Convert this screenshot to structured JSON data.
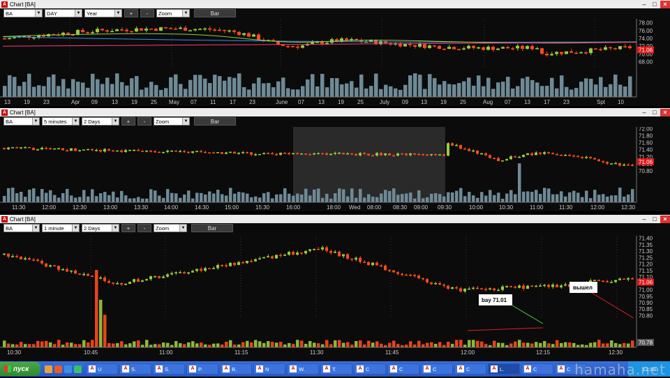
{
  "colors": {
    "up": "#9ccc3a",
    "down": "#ff4a1a",
    "volume": "#6e8a96",
    "price_tag": "#e01818",
    "grid": "#3a3a3a",
    "ma1": "#3a8ee6",
    "ma2": "#8fd13a",
    "ma3": "#ff3a7a"
  },
  "windows": [
    {
      "title": "Chart [BA]",
      "toolbar": {
        "symbol": "BA",
        "interval": "DAY",
        "range": "Year",
        "plus": "+",
        "minus": "-",
        "zoom": "Zoom",
        "style": "Bar"
      },
      "price_axis": [
        "78.00",
        "76.00",
        "74.00",
        "72.00",
        "70.00",
        "68.00"
      ],
      "price_tag": "71.06",
      "time_axis": [
        "13",
        "19",
        "23",
        "Apr",
        "09",
        "13",
        "19",
        "25",
        "May",
        "07",
        "11",
        "17",
        "23",
        "June",
        "07",
        "13",
        "19",
        "25",
        "July",
        "09",
        "13",
        "19",
        "25",
        "Aug",
        "07",
        "13",
        "17",
        "23",
        "Spt",
        "10"
      ],
      "chart_data": {
        "type": "candlestick",
        "y_min": 66.5,
        "y_max": 79.0,
        "y_ticks": [
          78,
          76,
          74,
          72,
          70,
          68
        ],
        "last": 71.06
      }
    },
    {
      "title": "Chart [BA]",
      "toolbar": {
        "symbol": "BA",
        "interval": "5 minutes",
        "range": "2 Days",
        "plus": "+",
        "minus": "-",
        "zoom": "Zoom",
        "style": "Bar"
      },
      "price_axis": [
        "72.00",
        "71.80",
        "71.60",
        "71.40",
        "71.20",
        "71.00",
        "70.80"
      ],
      "price_tag": "71.06",
      "time_axis": [
        "11:30",
        "12:00",
        "12:30",
        "13:00",
        "13:30",
        "14:00",
        "14:30",
        "15:00",
        "15:30",
        "16:00",
        "18:00",
        "Wed",
        "08:00",
        "08:30",
        "09:00",
        "09:30",
        "10:00",
        "10:30",
        "11:00",
        "11:30",
        "12:00",
        "12:30"
      ],
      "chart_data": {
        "type": "candlestick",
        "y_min": 70.7,
        "y_max": 72.05,
        "y_ticks": [
          72.0,
          71.8,
          71.6,
          71.4,
          71.2,
          71.0,
          70.8
        ],
        "last": 71.06
      }
    },
    {
      "title": "Chart [BA]",
      "toolbar": {
        "symbol": "BA",
        "interval": "1 minute",
        "range": "2 Days",
        "plus": "+",
        "minus": "-",
        "zoom": "Zoom",
        "style": "Bar"
      },
      "price_axis": [
        "71.40",
        "71.35",
        "71.30",
        "71.25",
        "71.20",
        "71.15",
        "71.10",
        "71.05",
        "71.00",
        "70.95",
        "70.90",
        "70.85",
        "70.80"
      ],
      "price_tag": "71.06",
      "volume_tag": "70.78",
      "time_axis": [
        "10:30",
        "10:45",
        "11:00",
        "11:15",
        "11:30",
        "11:45",
        "12:00",
        "12:15",
        "12:30"
      ],
      "annotations": {
        "buy": "bay 71.01",
        "exit": "вышел"
      },
      "chart_data": {
        "type": "candlestick",
        "y_min": 70.77,
        "y_max": 71.42,
        "y_ticks": [
          71.4,
          71.35,
          71.3,
          71.25,
          71.2,
          71.15,
          71.1,
          71.05,
          71.0,
          70.95,
          70.9,
          70.85,
          70.8
        ],
        "last": 71.06,
        "buy_price": 71.01
      }
    }
  ],
  "taskbar": {
    "start": "пуск",
    "tasks": [
      "U",
      "S.",
      "S.",
      "P.",
      "B.",
      "N",
      "W.",
      "T.",
      "C",
      "C",
      "C",
      "C",
      "L.",
      "C",
      "C"
    ],
    "clock": "12:30"
  },
  "watermark": "hamaha.net"
}
